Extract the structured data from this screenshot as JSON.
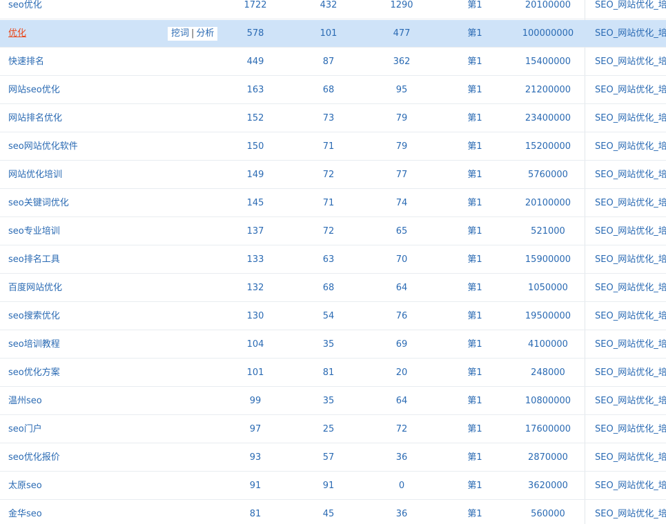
{
  "table": {
    "actions": {
      "dig": "挖词",
      "sep": "|",
      "analyze": "分析"
    },
    "rows": [
      {
        "keyword": "seo优化",
        "col1": "1722",
        "col2": "432",
        "col3": "1290",
        "rank": "第1",
        "index": "20100000",
        "title": "SEO_网站优化_培"
      },
      {
        "keyword": "优化",
        "col1": "578",
        "col2": "101",
        "col3": "477",
        "rank": "第1",
        "index": "100000000",
        "title": "SEO_网站优化_培"
      },
      {
        "keyword": "快速排名",
        "col1": "449",
        "col2": "87",
        "col3": "362",
        "rank": "第1",
        "index": "15400000",
        "title": "SEO_网站优化_培"
      },
      {
        "keyword": "网站seo优化",
        "col1": "163",
        "col2": "68",
        "col3": "95",
        "rank": "第1",
        "index": "21200000",
        "title": "SEO_网站优化_培"
      },
      {
        "keyword": "网站排名优化",
        "col1": "152",
        "col2": "73",
        "col3": "79",
        "rank": "第1",
        "index": "23400000",
        "title": "SEO_网站优化_培"
      },
      {
        "keyword": "seo网站优化软件",
        "col1": "150",
        "col2": "71",
        "col3": "79",
        "rank": "第1",
        "index": "15200000",
        "title": "SEO_网站优化_培"
      },
      {
        "keyword": "网站优化培训",
        "col1": "149",
        "col2": "72",
        "col3": "77",
        "rank": "第1",
        "index": "5760000",
        "title": "SEO_网站优化_培"
      },
      {
        "keyword": "seo关键词优化",
        "col1": "145",
        "col2": "71",
        "col3": "74",
        "rank": "第1",
        "index": "20100000",
        "title": "SEO_网站优化_培"
      },
      {
        "keyword": "seo专业培训",
        "col1": "137",
        "col2": "72",
        "col3": "65",
        "rank": "第1",
        "index": "521000",
        "title": "SEO_网站优化_培"
      },
      {
        "keyword": "seo排名工具",
        "col1": "133",
        "col2": "63",
        "col3": "70",
        "rank": "第1",
        "index": "15900000",
        "title": "SEO_网站优化_培"
      },
      {
        "keyword": "百度网站优化",
        "col1": "132",
        "col2": "68",
        "col3": "64",
        "rank": "第1",
        "index": "1050000",
        "title": "SEO_网站优化_培"
      },
      {
        "keyword": "seo搜索优化",
        "col1": "130",
        "col2": "54",
        "col3": "76",
        "rank": "第1",
        "index": "19500000",
        "title": "SEO_网站优化_培"
      },
      {
        "keyword": "seo培训教程",
        "col1": "104",
        "col2": "35",
        "col3": "69",
        "rank": "第1",
        "index": "4100000",
        "title": "SEO_网站优化_培"
      },
      {
        "keyword": "seo优化方案",
        "col1": "101",
        "col2": "81",
        "col3": "20",
        "rank": "第1",
        "index": "248000",
        "title": "SEO_网站优化_培"
      },
      {
        "keyword": "温州seo",
        "col1": "99",
        "col2": "35",
        "col3": "64",
        "rank": "第1",
        "index": "10800000",
        "title": "SEO_网站优化_培"
      },
      {
        "keyword": "seo门户",
        "col1": "97",
        "col2": "25",
        "col3": "72",
        "rank": "第1",
        "index": "17600000",
        "title": "SEO_网站优化_培"
      },
      {
        "keyword": "seo优化报价",
        "col1": "93",
        "col2": "57",
        "col3": "36",
        "rank": "第1",
        "index": "2870000",
        "title": "SEO_网站优化_培"
      },
      {
        "keyword": "太原seo",
        "col1": "91",
        "col2": "91",
        "col3": "0",
        "rank": "第1",
        "index": "3620000",
        "title": "SEO_网站优化_培"
      },
      {
        "keyword": "金华seo",
        "col1": "81",
        "col2": "45",
        "col3": "36",
        "rank": "第1",
        "index": "560000",
        "title": "SEO_网站优化_培"
      }
    ]
  }
}
